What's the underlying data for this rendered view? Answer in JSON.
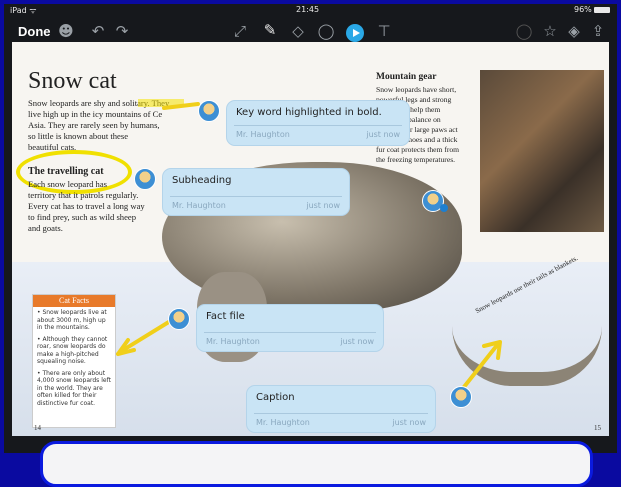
{
  "statusbar": {
    "device": "iPad ᯤ",
    "time": "21:45",
    "battery": "96%"
  },
  "toolbar": {
    "done_label": "Done"
  },
  "page": {
    "title": "Snow cat",
    "intro": [
      "Snow leopards are shy and solitary. They",
      "live high up in the icy mountains of Ce",
      "Asia. They are rarely seen by humans,",
      "so little is known about these",
      "beautiful cats."
    ],
    "subheading": "The travelling cat",
    "travel_text": [
      "Each snow leopard has",
      "territory that it patrols regularly.",
      "Every cat has to travel a long way",
      "to find prey, such as wild sheep",
      "and goats."
    ],
    "mountain_title": "Mountain gear",
    "mountain_text": [
      "Snow leopards have short,",
      "powerful legs and strong",
      "muscles to help them",
      "keep their balance on",
      "rocks. Their large paws act",
      "like snowshoes and a thick",
      "fur coat protects them from",
      "the freezing temperatures."
    ],
    "fact_box": {
      "title": "Cat Facts",
      "items": [
        "• Snow leopards live at about 3000 m, high up in the mountains.",
        "• Although they cannot roar, snow leopards do make a high-pitched squealing noise.",
        "• There are only about 4,000 snow leopards left in the world. They are often killed for their distinctive fur coat."
      ]
    },
    "tail_caption": "Snow leopards use their tails as blankets.",
    "page_left": "14",
    "page_right": "15"
  },
  "callouts": [
    {
      "text": "Key word highlighted in bold.",
      "author": "Mr. Haughton",
      "when": "just now"
    },
    {
      "text": "Subheading",
      "author": "Mr. Haughton",
      "when": "just now"
    },
    {
      "text": "Fact file",
      "author": "Mr. Haughton",
      "when": "just now"
    },
    {
      "text": "Caption",
      "author": "Mr. Haughton",
      "when": "just now"
    }
  ]
}
